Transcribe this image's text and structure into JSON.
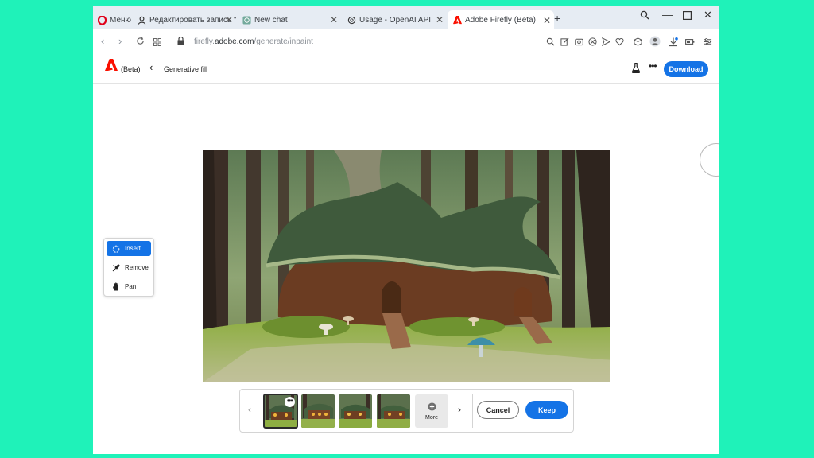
{
  "browser": {
    "menu_label": "Меню",
    "tabs": [
      {
        "title": "Редактировать запись \"М",
        "icon": "user-icon"
      },
      {
        "title": "New chat",
        "icon": "chatgpt-icon"
      },
      {
        "title": "Usage - OpenAI API",
        "icon": "openai-icon"
      },
      {
        "title": "Adobe Firefly (Beta)",
        "icon": "adobe-icon",
        "active": true
      }
    ],
    "new_tab": "+",
    "url_prefix": "firefly.",
    "url_domain": "adobe.com",
    "url_path": "/generate/inpaint"
  },
  "app": {
    "beta_label": "(Beta)",
    "back_label": "‹",
    "page_title": "Generative fill",
    "more_label": "•••",
    "download_label": "Download"
  },
  "tools": [
    {
      "label": "Insert",
      "icon": "insert-brush-icon",
      "active": true
    },
    {
      "label": "Remove",
      "icon": "remove-brush-icon",
      "active": false
    },
    {
      "label": "Pan",
      "icon": "hand-icon",
      "active": false
    }
  ],
  "variations": {
    "more_label": "More",
    "cancel_label": "Cancel",
    "keep_label": "Keep"
  },
  "colors": {
    "accent": "#1473e6",
    "background": "#1ff2b9",
    "opera_red": "#e0001a",
    "adobe_red": "#fa0f00"
  }
}
